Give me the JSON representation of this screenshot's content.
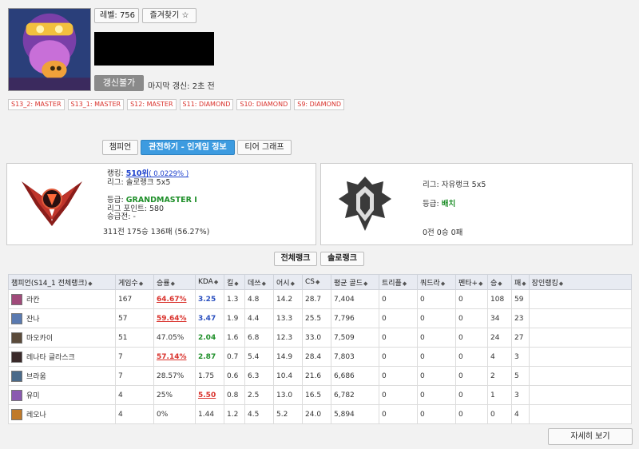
{
  "header": {
    "level_label": "레벨: 756",
    "favorite_label": "즐겨찾기 ☆",
    "refresh_label": "갱신불가",
    "last_update": "마지막 갱신: 2초 전"
  },
  "seasons": [
    "S13_2: MASTER",
    "S13_1: MASTER",
    "S12: MASTER",
    "S11: DIAMOND",
    "S10: DIAMOND",
    "S9: DIAMOND"
  ],
  "tabs": {
    "champion": "챔피언",
    "spectate": "관전하기 - 인게임 정보",
    "tier_graph": "티어 그래프"
  },
  "solo": {
    "ranking_label": "랭킹: ",
    "ranking_value": "510위",
    "ranking_pct": "( 0.0229% )",
    "league": "리그: 솔로랭크 5x5",
    "tier_label": "등급: ",
    "tier_value": "GRANDMASTER I",
    "lp": "리그 포인트: 580",
    "promo": "승급전: -",
    "record": "311전 175승 136패 (56.27%)"
  },
  "flex": {
    "league": "리그: 자유랭크 5x5",
    "tier_label": "등급: ",
    "tier_value": "배치",
    "record": "0전 0승 0패"
  },
  "filters": {
    "all_rank": "전체랭크",
    "solo_rank": "솔로랭크"
  },
  "table": {
    "columns": [
      "챔피언(S14_1 전체랭크)",
      "게임수",
      "승률",
      "KDA",
      "킬",
      "데쓰",
      "어시",
      "CS",
      "평균 골드",
      "트리플",
      "쿼드라",
      "펜타+",
      "승",
      "패",
      "장인랭킹"
    ],
    "rows": [
      {
        "name": "라칸",
        "games": "167",
        "wr": "64.67%",
        "kda": "3.25",
        "k": "1.3",
        "d": "4.8",
        "a": "14.2",
        "cs": "28.7",
        "gold": "7,404",
        "triple": "0",
        "quadra": "0",
        "penta": "0",
        "w": "108",
        "l": "59",
        "rank": ""
      },
      {
        "name": "잔나",
        "games": "57",
        "wr": "59.64%",
        "kda": "3.47",
        "k": "1.9",
        "d": "4.4",
        "a": "13.3",
        "cs": "25.5",
        "gold": "7,796",
        "triple": "0",
        "quadra": "0",
        "penta": "0",
        "w": "34",
        "l": "23",
        "rank": ""
      },
      {
        "name": "마오카이",
        "games": "51",
        "wr": "47.05%",
        "kda": "2.04",
        "k": "1.6",
        "d": "6.8",
        "a": "12.3",
        "cs": "33.0",
        "gold": "7,509",
        "triple": "0",
        "quadra": "0",
        "penta": "0",
        "w": "24",
        "l": "27",
        "rank": ""
      },
      {
        "name": "레나타 글라스크",
        "games": "7",
        "wr": "57.14%",
        "kda": "2.87",
        "k": "0.7",
        "d": "5.4",
        "a": "14.9",
        "cs": "28.4",
        "gold": "7,803",
        "triple": "0",
        "quadra": "0",
        "penta": "0",
        "w": "4",
        "l": "3",
        "rank": ""
      },
      {
        "name": "브라움",
        "games": "7",
        "wr": "28.57%",
        "kda": "1.75",
        "k": "0.6",
        "d": "6.3",
        "a": "10.4",
        "cs": "21.6",
        "gold": "6,686",
        "triple": "0",
        "quadra": "0",
        "penta": "0",
        "w": "2",
        "l": "5",
        "rank": ""
      },
      {
        "name": "유미",
        "games": "4",
        "wr": "25%",
        "kda": "5.50",
        "k": "0.8",
        "d": "2.5",
        "a": "13.0",
        "cs": "16.5",
        "gold": "6,782",
        "triple": "0",
        "quadra": "0",
        "penta": "0",
        "w": "1",
        "l": "3",
        "rank": ""
      },
      {
        "name": "레오나",
        "games": "4",
        "wr": "0%",
        "kda": "1.44",
        "k": "1.2",
        "d": "4.5",
        "a": "5.2",
        "cs": "24.0",
        "gold": "5,894",
        "triple": "0",
        "quadra": "0",
        "penta": "0",
        "w": "0",
        "l": "4",
        "rank": ""
      }
    ]
  },
  "detail_label": "자세히 보기",
  "colors": {
    "accent_blue": "#3d9be0",
    "win_red": "#d9312b",
    "kda_blue": "#2a4fbf",
    "kda_green": "#1f8f2a"
  }
}
